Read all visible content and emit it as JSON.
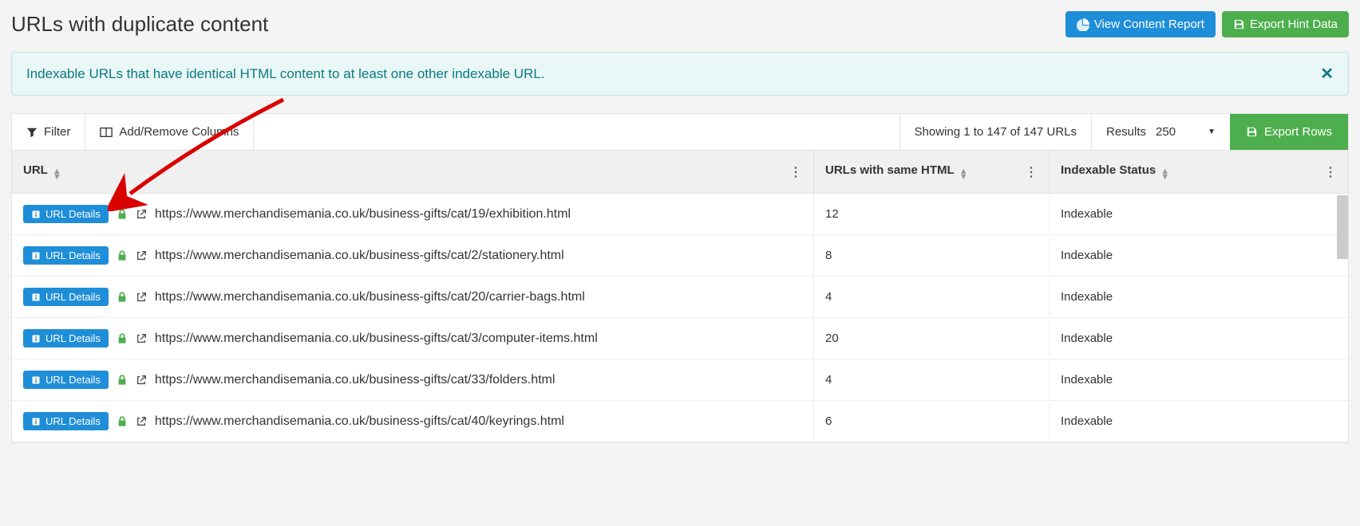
{
  "header": {
    "title": "URLs with duplicate content",
    "view_report_label": "View Content Report",
    "export_hint_label": "Export Hint Data"
  },
  "alert": {
    "text": "Indexable URLs that have identical HTML content to at least one other indexable URL."
  },
  "toolbar": {
    "filter_label": "Filter",
    "columns_label": "Add/Remove Columns",
    "showing_text": "Showing 1 to 147 of 147 URLs",
    "results_label": "Results",
    "results_value": "250",
    "export_rows_label": "Export Rows"
  },
  "table": {
    "headers": {
      "url": "URL",
      "count": "URLs with same HTML",
      "status": "Indexable Status"
    },
    "url_details_label": "URL Details",
    "rows": [
      {
        "url": "https://www.merchandisemania.co.uk/business-gifts/cat/19/exhibition.html",
        "count": "12",
        "status": "Indexable"
      },
      {
        "url": "https://www.merchandisemania.co.uk/business-gifts/cat/2/stationery.html",
        "count": "8",
        "status": "Indexable"
      },
      {
        "url": "https://www.merchandisemania.co.uk/business-gifts/cat/20/carrier-bags.html",
        "count": "4",
        "status": "Indexable"
      },
      {
        "url": "https://www.merchandisemania.co.uk/business-gifts/cat/3/computer-items.html",
        "count": "20",
        "status": "Indexable"
      },
      {
        "url": "https://www.merchandisemania.co.uk/business-gifts/cat/33/folders.html",
        "count": "4",
        "status": "Indexable"
      },
      {
        "url": "https://www.merchandisemania.co.uk/business-gifts/cat/40/keyrings.html",
        "count": "6",
        "status": "Indexable"
      }
    ]
  }
}
